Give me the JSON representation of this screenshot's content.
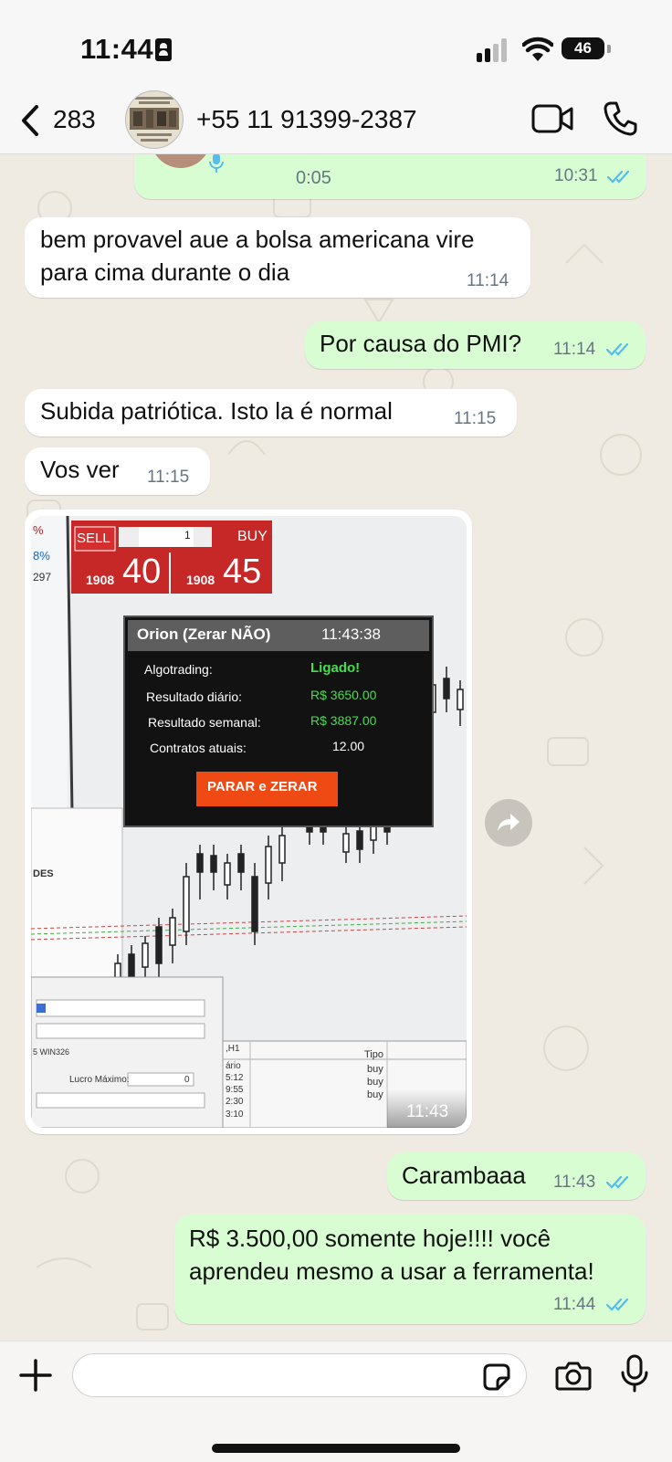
{
  "status_bar": {
    "time": "11:44",
    "battery": "46"
  },
  "header": {
    "back_count": "283",
    "contact": "+55 11 91399-2387"
  },
  "top_voice": {
    "duration": "0:05",
    "time": "10:31"
  },
  "messages": [
    {
      "dir": "in",
      "lines": [
        "bem provavel aue a bolsa americana vire",
        "para cima durante o dia"
      ],
      "time": "11:14"
    },
    {
      "dir": "out",
      "lines": [
        "Por causa do PMI?"
      ],
      "time": "11:14"
    },
    {
      "dir": "in",
      "lines": [
        "Subida patriótica.  Isto la é normal"
      ],
      "time": "11:15"
    },
    {
      "dir": "in",
      "lines": [
        "Vos ver"
      ],
      "time": "11:15"
    },
    {
      "dir": "out",
      "lines": [
        "Carambaaa"
      ],
      "time": "11:43"
    },
    {
      "dir": "out",
      "lines": [
        "R$ 3.500,00 somente hoje!!!! você",
        "aprendeu mesmo a usar a ferramenta!"
      ],
      "time": "11:44"
    }
  ],
  "image_message": {
    "time": "11:43",
    "sell_label": "SELL",
    "buy_label": "BUY",
    "qty": "1",
    "sell_price_small": "1908",
    "sell_price_big": "40",
    "buy_price_small": "1908",
    "buy_price_big": "45",
    "panel_title": "Orion (Zerar NÃO)",
    "panel_clock": "11:43:38",
    "rows": [
      {
        "label": "Algotrading:",
        "value": "Ligado!"
      },
      {
        "label": "Resultado diário:",
        "value": "R$ 3650.00"
      },
      {
        "label": "Resultado semanal:",
        "value": "R$ 3887.00"
      },
      {
        "label": "Contratos atuais:",
        "value": "12.00"
      }
    ],
    "stop_button": "PARAR e ZERAR",
    "left_pct_1": "%",
    "left_pct_2": "8%",
    "left_num": "297",
    "left_des": "DES",
    "dialog_symbol": "5 WIN326",
    "dialog_lucro": "Lucro Máximo:",
    "dialog_zero": "0",
    "table_col": "Tipo",
    "table_h1": ",H1",
    "table_rows": [
      {
        "time": "ário",
        "type": "Tipo"
      },
      {
        "time": "5:12",
        "type": "buy"
      },
      {
        "time": "9:55",
        "type": "buy"
      },
      {
        "time": "2:30",
        "type": "buy"
      },
      {
        "time": "3:10",
        "type": ""
      }
    ]
  },
  "composer": {
    "placeholder": ""
  }
}
